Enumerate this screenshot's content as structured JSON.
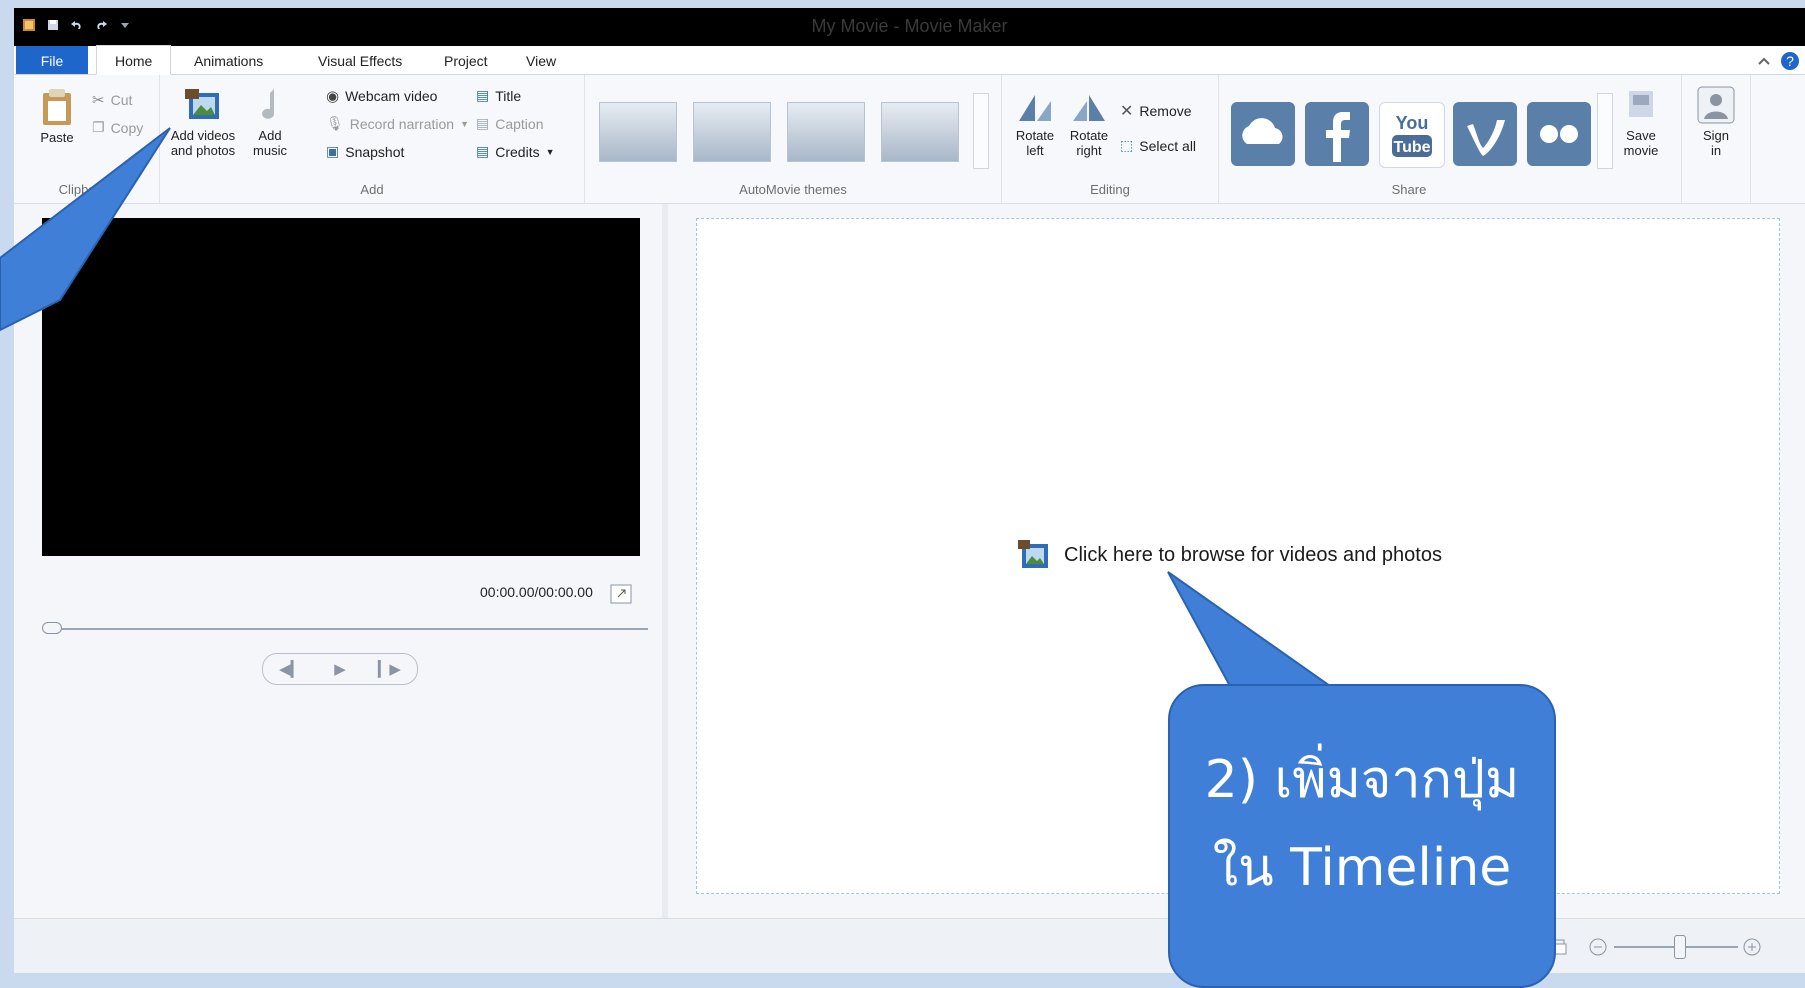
{
  "window": {
    "title": "My Movie - Movie Maker"
  },
  "tabs": [
    "File",
    "Home",
    "Animations",
    "Visual Effects",
    "Project",
    "View"
  ],
  "ribbon": {
    "clipboard": {
      "paste": "Paste",
      "cut": "Cut",
      "copy": "Copy",
      "label": "Clipboard"
    },
    "add": {
      "add_videos_1": "Add videos",
      "add_videos_2": "and photos",
      "add_music_1": "Add",
      "add_music_2": "music",
      "webcam": "Webcam video",
      "narration": "Record narration",
      "snapshot": "Snapshot",
      "title": "Title",
      "caption": "Caption",
      "credits": "Credits",
      "label": "Add"
    },
    "automovie": {
      "label": "AutoMovie themes"
    },
    "editing": {
      "rotate_left_1": "Rotate",
      "rotate_left_2": "left",
      "rotate_right_1": "Rotate",
      "rotate_right_2": "right",
      "remove": "Remove",
      "select_all": "Select all",
      "label": "Editing"
    },
    "share": {
      "label": "Share",
      "save_1": "Save",
      "save_2": "movie",
      "sign_1": "Sign",
      "sign_2": "in",
      "icons": [
        "onedrive-icon",
        "facebook-icon",
        "youtube-icon",
        "vimeo-icon",
        "flickr-icon"
      ]
    }
  },
  "preview": {
    "time": "00:00.00/00:00.00"
  },
  "timeline": {
    "browse_text": "Click here to browse for videos and photos"
  },
  "callout": {
    "line1": "2) เพิ่มจากปุ่ม",
    "line2": "ใน Timeline"
  },
  "colors": {
    "accent": "#1e66c9",
    "callout": "#3f7fd7"
  }
}
